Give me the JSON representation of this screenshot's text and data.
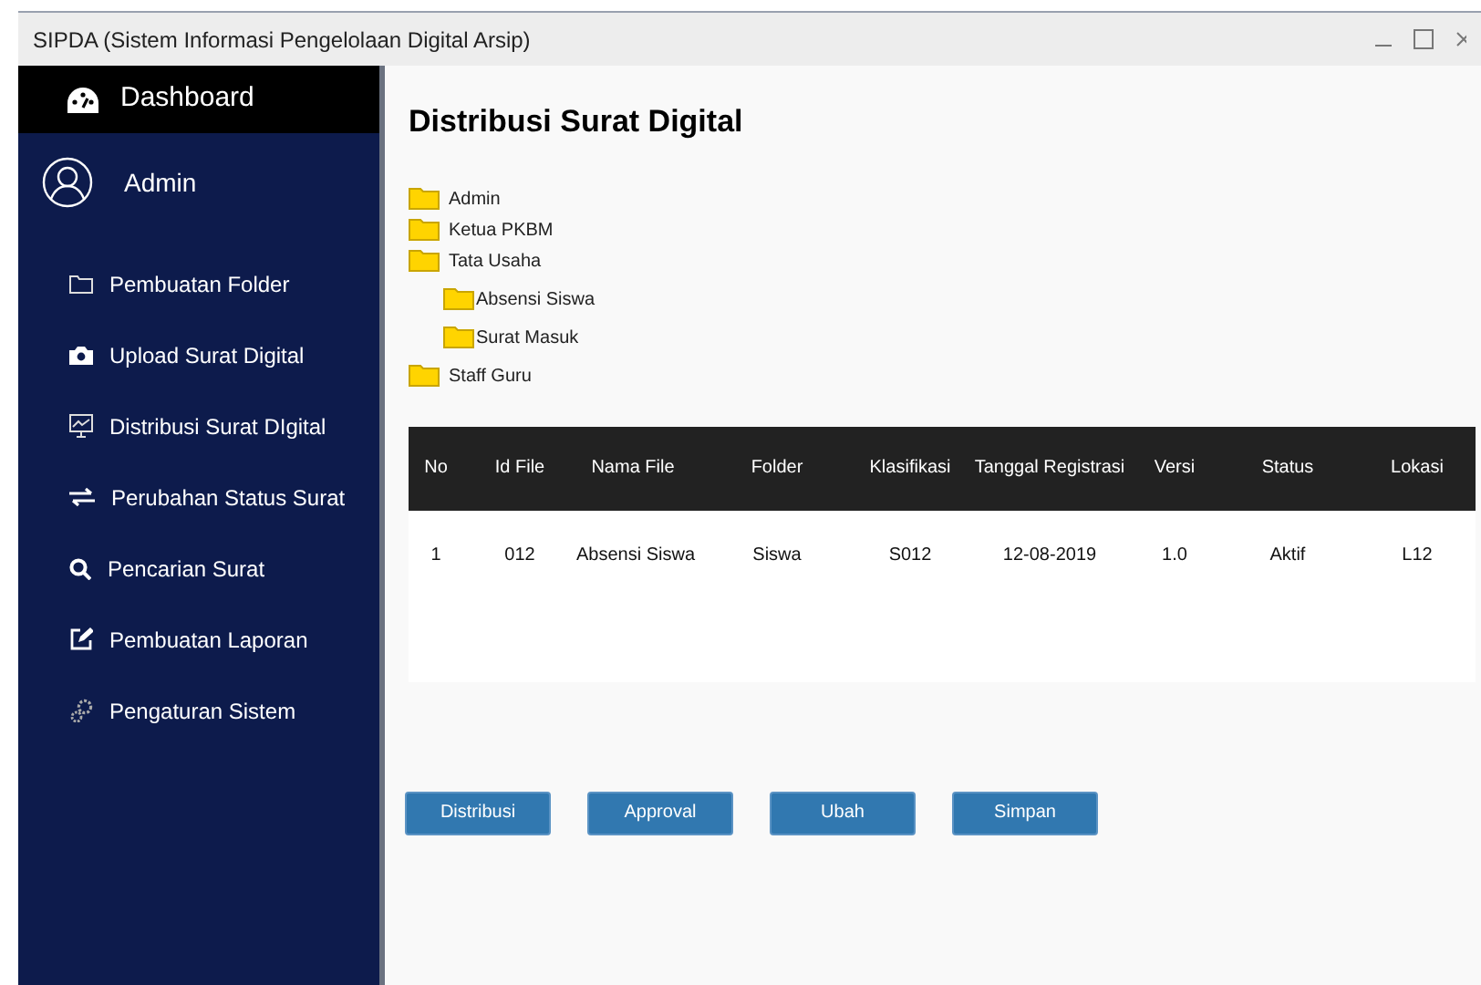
{
  "window": {
    "title": "SIPDA (Sistem Informasi Pengelolaan Digital Arsip)"
  },
  "sidebar": {
    "header": "Dashboard",
    "user": "Admin",
    "items": [
      {
        "label": "Pembuatan Folder",
        "kind": "folder"
      },
      {
        "label": "Upload Surat Digital",
        "kind": "camera"
      },
      {
        "label": "Distribusi Surat DIgital",
        "kind": "presentation"
      },
      {
        "label": "Perubahan Status Surat",
        "kind": "exchange"
      },
      {
        "label": "Pencarian Surat",
        "kind": "search"
      },
      {
        "label": "Pembuatan Laporan",
        "kind": "edit"
      },
      {
        "label": "Pengaturan Sistem",
        "kind": "gears"
      }
    ]
  },
  "page": {
    "title": "Distribusi Surat Digital"
  },
  "folder_tree": [
    {
      "label": "Admin"
    },
    {
      "label": "Ketua PKBM"
    },
    {
      "label": "Tata Usaha",
      "children": [
        {
          "label": "Absensi Siswa"
        },
        {
          "label": "Surat Masuk"
        }
      ]
    },
    {
      "label": "Staff Guru"
    }
  ],
  "table": {
    "columns": [
      "No",
      "Id File",
      "Nama File",
      "Folder",
      "Klasifikasi",
      "Tanggal Registrasi",
      "Versi",
      "Status",
      "Lokasi"
    ],
    "rows": [
      [
        "1",
        "012",
        "Absensi Siswa",
        "Siswa",
        "S012",
        "12-08-2019",
        "1.0",
        "Aktif",
        "L12"
      ]
    ]
  },
  "buttons": [
    "Distribusi",
    "Approval",
    "Ubah",
    "Simpan"
  ]
}
